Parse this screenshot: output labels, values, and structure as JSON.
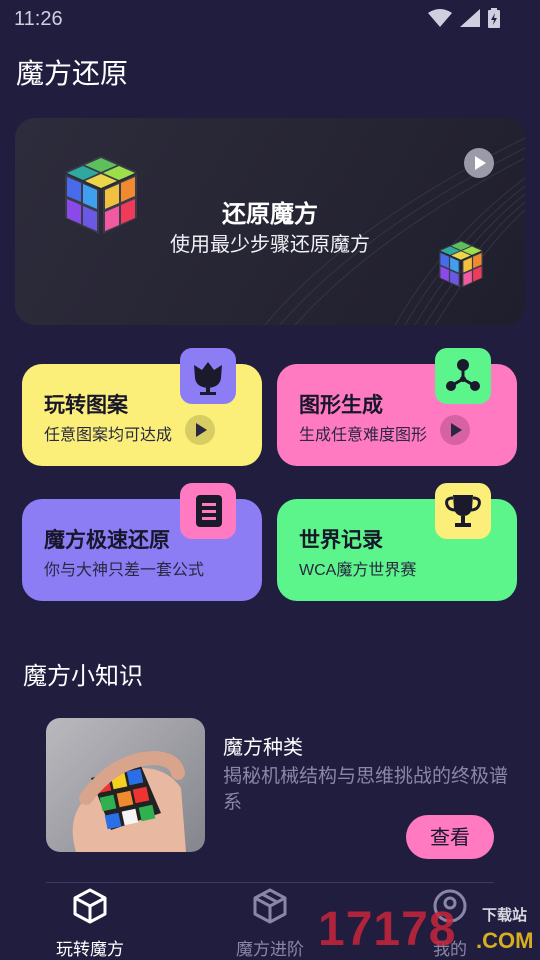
{
  "status_bar": {
    "time": "11:26"
  },
  "header": {
    "title": "魔方还原"
  },
  "hero": {
    "title": "还原魔方",
    "subtitle": "使用最少步骤还原魔方",
    "play_icon": "play-icon"
  },
  "cards": [
    {
      "title": "玩转图案",
      "subtitle": "任意图案均可达成",
      "color": "#fbef7a",
      "badge_color": "#8c7df5",
      "icon": "flower-icon"
    },
    {
      "title": "图形生成",
      "subtitle": "生成任意难度图形",
      "color": "#ff7ac1",
      "badge_color": "#5cf58c",
      "icon": "network-icon"
    },
    {
      "title": "魔方极速还原",
      "subtitle": "你与大神只差一套公式",
      "color": "#8c7df5",
      "badge_color": "#ff7ac1",
      "icon": "book-icon"
    },
    {
      "title": "世界记录",
      "subtitle": "WCA魔方世界赛",
      "color": "#5cf58c",
      "badge_color": "#fbef7a",
      "icon": "trophy-icon"
    }
  ],
  "knowledge": {
    "section_title": "魔方小知识",
    "title": "魔方种类",
    "description": "揭秘机械结构与思维挑战的终极谱系",
    "button_label": "查看"
  },
  "bottom_nav": {
    "items": [
      {
        "label": "玩转魔方",
        "active": true,
        "icon": "cube-icon"
      },
      {
        "label": "魔方进阶",
        "active": false,
        "icon": "cube-outline-icon"
      },
      {
        "label": "我的",
        "active": false,
        "icon": "profile-icon"
      }
    ]
  },
  "watermark": {
    "number": "17178",
    "cn": "下载站",
    "com": ".COM"
  },
  "colors": {
    "background": "#211d3f",
    "accent_pink": "#ff7ac1"
  }
}
